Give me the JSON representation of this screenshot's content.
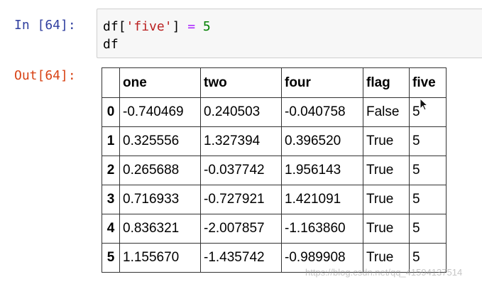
{
  "cell": {
    "in_prompt": "In [64]:",
    "out_prompt": "Out[64]:",
    "code": {
      "line1": {
        "var": "df",
        "open": "[",
        "key": "'five'",
        "close": "]",
        "assign": " = ",
        "value": "5"
      },
      "line2": "df"
    }
  },
  "dataframe": {
    "corner": "",
    "columns": [
      "one",
      "two",
      "four",
      "flag",
      "five"
    ],
    "rows": [
      {
        "index": "0",
        "cells": [
          "-0.740469",
          "0.240503",
          "-0.040758",
          "False",
          "5"
        ]
      },
      {
        "index": "1",
        "cells": [
          "0.325556",
          "1.327394",
          "0.396520",
          "True",
          "5"
        ]
      },
      {
        "index": "2",
        "cells": [
          "0.265688",
          "-0.037742",
          "1.956143",
          "True",
          "5"
        ]
      },
      {
        "index": "3",
        "cells": [
          "0.716933",
          "-0.727921",
          "1.421091",
          "True",
          "5"
        ]
      },
      {
        "index": "4",
        "cells": [
          "0.836321",
          "-2.007857",
          "-1.163860",
          "True",
          "5"
        ]
      },
      {
        "index": "5",
        "cells": [
          "1.155670",
          "-1.435742",
          "-0.989908",
          "True",
          "5"
        ]
      }
    ]
  },
  "watermark": "https://blog.csdn.net/qq_41594137514",
  "icons": {
    "cursor": "mouse-pointer-icon"
  },
  "colors": {
    "in_prompt": "#303f9f",
    "out_prompt": "#d84315",
    "string": "#ba2121",
    "operator": "#aa22ff",
    "number": "#008000"
  }
}
